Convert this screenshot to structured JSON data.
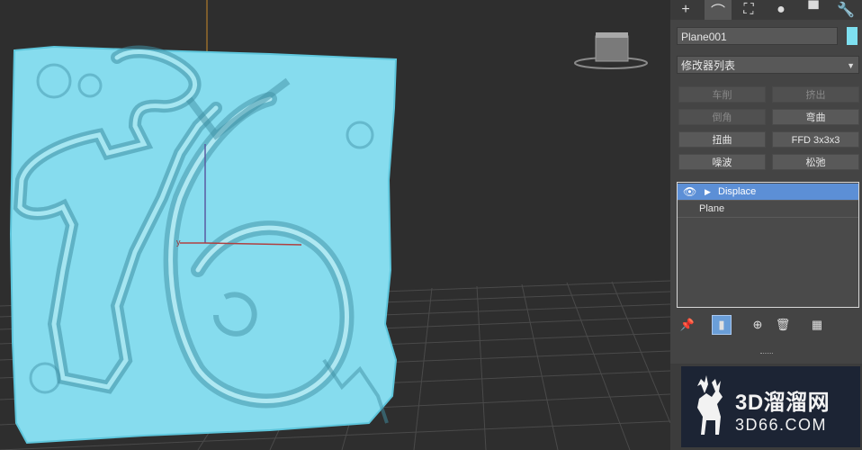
{
  "command_panel": {
    "tabs": [
      {
        "name": "create-tab",
        "glyph": "+"
      },
      {
        "name": "modify-tab",
        "glyph": "⌒"
      },
      {
        "name": "hierarchy-tab",
        "glyph": "⛶"
      },
      {
        "name": "motion-tab",
        "glyph": "●"
      },
      {
        "name": "display-tab",
        "glyph": "▀"
      },
      {
        "name": "utilities-tab",
        "glyph": "🔧"
      }
    ],
    "object_name": "Plane001",
    "object_color": "#7ee0f0",
    "modifier_list_label": "修改器列表",
    "modifier_buttons": [
      {
        "label": "车削",
        "enabled": false
      },
      {
        "label": "挤出",
        "enabled": false
      },
      {
        "label": "倒角",
        "enabled": false
      },
      {
        "label": "弯曲",
        "enabled": true
      },
      {
        "label": "扭曲",
        "enabled": true
      },
      {
        "label": "FFD 3x3x3",
        "enabled": true
      },
      {
        "label": "噪波",
        "enabled": true
      },
      {
        "label": "松弛",
        "enabled": true
      }
    ],
    "stack": [
      {
        "label": "Displace",
        "selected": true
      },
      {
        "label": "Plane",
        "selected": false
      }
    ],
    "stack_tools": [
      "pin-icon",
      "show-end-result-icon",
      "make-unique-icon",
      "remove-modifier-icon",
      "configure-sets-icon"
    ]
  },
  "watermark": {
    "line1": "3D溜溜网",
    "line2": "3D66.COM"
  },
  "viewport": {
    "object_color": "#7ee0f0"
  }
}
